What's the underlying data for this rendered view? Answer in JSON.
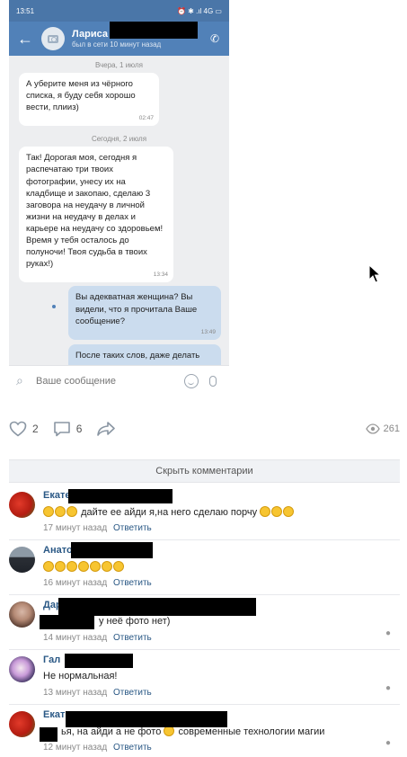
{
  "phone": {
    "status_time": "13:51",
    "status_right": "⏰ ✱ .ıl 4G ▭",
    "contact_name": "Лариса",
    "contact_status": "был в сети 10 минут назад",
    "messages": [
      {
        "kind": "date",
        "text": "Вчера, 1 июля"
      },
      {
        "kind": "in",
        "text": "А уберите меня из чёрного списка,  я буду себя хорошо вести,  плииз)",
        "time": "02:47"
      },
      {
        "kind": "date",
        "text": "Сегодня, 2 июля"
      },
      {
        "kind": "in",
        "text": "Так! Дорогая моя,  сегодня я распечатаю три твоих фотографии,  унесу их на кладбище и закопаю,  сделаю 3 заговора на неудачу в личной жизни на неудачу в делах и карьере на неудачу со здоровьем!  Время у тебя осталось до полуночи!  Твоя судьба в твоих руках!)",
        "time": "13:34"
      },
      {
        "kind": "out",
        "text": "Вы адекватная женщина?  Вы видели,  что я прочитала Ваше сообщение?",
        "time": "13:49"
      },
      {
        "kind": "out",
        "text": "После таких слов,  даже делать",
        "time": ""
      }
    ],
    "composer_placeholder": "Ваше сообщение"
  },
  "post": {
    "likes": "2",
    "comments": "6",
    "views": "261",
    "hide_comments": "Скрыть комментарии"
  },
  "comments": [
    {
      "author": "Екате",
      "text": "дайте ее айди я,на него сделаю порчу",
      "time": "17 минут назад",
      "reply": "Ответить",
      "avatar": "tomato"
    },
    {
      "author": "Анато",
      "text": "",
      "time": "16 минут назад",
      "reply": "Ответить",
      "avatar": "man"
    },
    {
      "author": "Дар",
      "text": "у неё фото нет)",
      "time": "14 минут назад",
      "reply": "Ответить",
      "avatar": "woman"
    },
    {
      "author": "Гал",
      "text": "Не нормальная!",
      "time": "13 минут назад",
      "reply": "Ответить",
      "avatar": "anime"
    },
    {
      "author": "Екат",
      "text": "ья, на айди а не фото",
      "text2": "современные технологии магии",
      "time": "12 минут назад",
      "reply": "Ответить",
      "avatar": "tomato"
    }
  ],
  "colors": {
    "vk_blue": "#5181b8",
    "link": "#2a5885"
  }
}
